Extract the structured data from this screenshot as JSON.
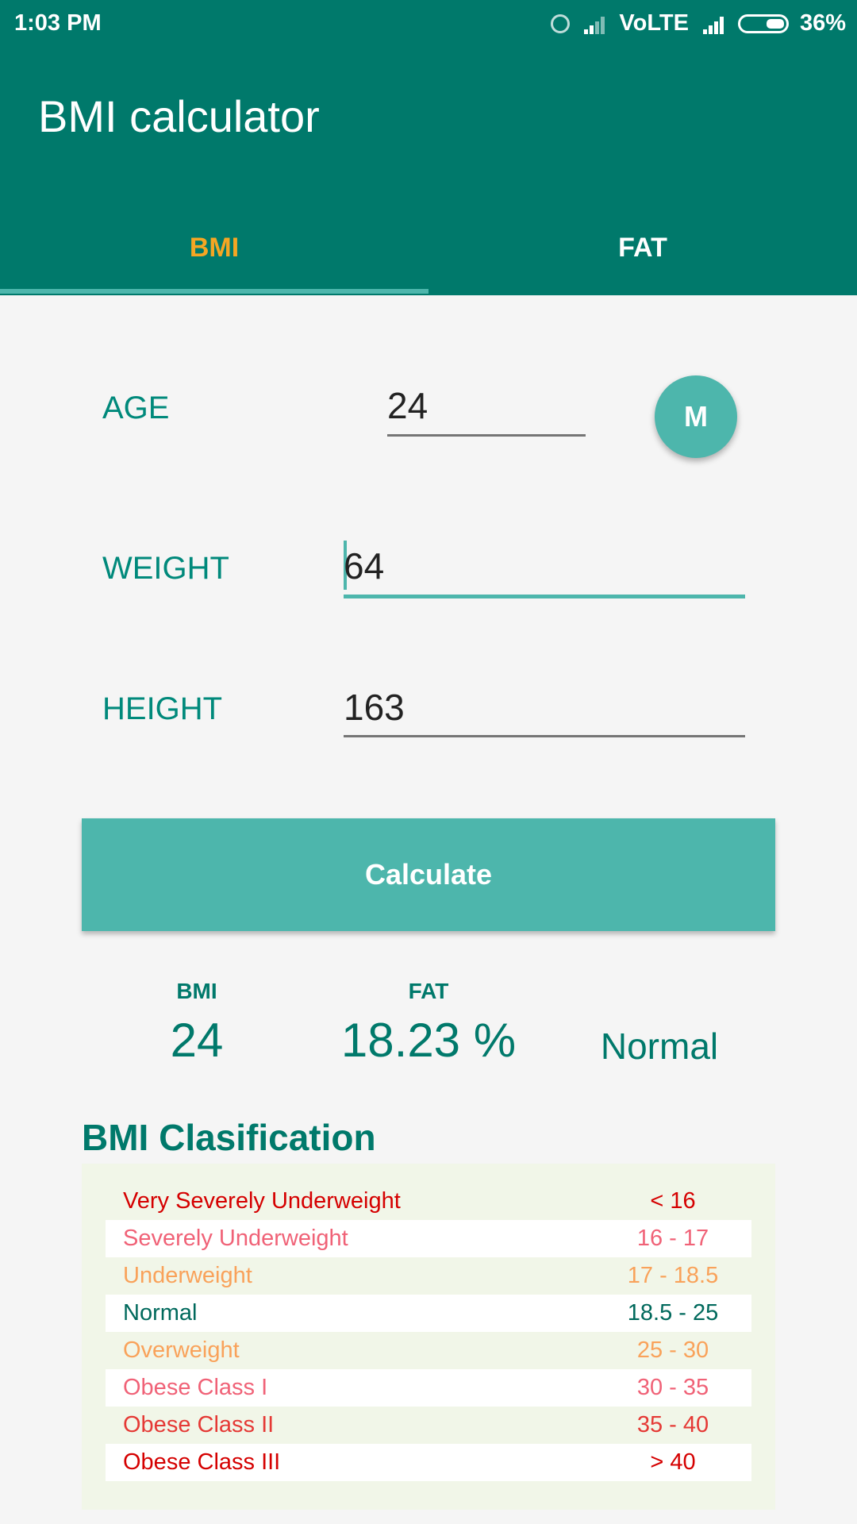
{
  "status_bar": {
    "time": "1:03 PM",
    "network": "VoLTE",
    "battery": "36%"
  },
  "app": {
    "title": "BMI calculator",
    "tabs": [
      {
        "label": "BMI",
        "selected": true
      },
      {
        "label": "FAT",
        "selected": false
      }
    ]
  },
  "form": {
    "age_label": "AGE",
    "age_value": "24",
    "gender_button": "M",
    "weight_label": "WEIGHT",
    "weight_value": "64",
    "height_label": "HEIGHT",
    "height_value": "163",
    "calculate_label": "Calculate"
  },
  "results": {
    "bmi_label": "BMI",
    "bmi_value": "24",
    "fat_label": "FAT",
    "fat_value": "18.23 %",
    "status": "Normal"
  },
  "classification": {
    "title": "BMI Clasification",
    "rows": [
      {
        "name": "Very Severely Underweight",
        "range": "< 16",
        "color": "#d50000"
      },
      {
        "name": "Severely Underweight",
        "range": "16 - 17",
        "color": "#f06277"
      },
      {
        "name": "Underweight",
        "range": "17 - 18.5",
        "color": "#f9a25a"
      },
      {
        "name": "Normal",
        "range": "18.5 - 25",
        "color": "#00695c"
      },
      {
        "name": "Overweight",
        "range": "25 - 30",
        "color": "#f9a25a"
      },
      {
        "name": "Obese Class I",
        "range": "30 - 35",
        "color": "#f06277"
      },
      {
        "name": "Obese Class II",
        "range": "35 - 40",
        "color": "#e53935"
      },
      {
        "name": "Obese Class III",
        "range": "> 40",
        "color": "#d50000"
      }
    ]
  },
  "colors": {
    "primary": "#00796b",
    "accent": "#4db6ac",
    "tab_selected": "#f5a623"
  }
}
